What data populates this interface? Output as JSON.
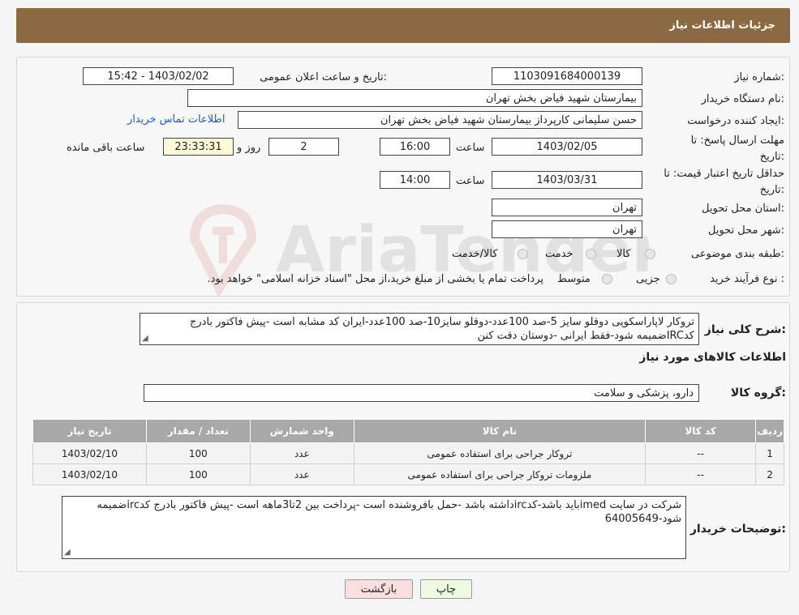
{
  "header": {
    "title": "جزئیات اطلاعات نیاز"
  },
  "form": {
    "need_number": {
      "label": "شماره نیاز:",
      "value": "1103091684000139"
    },
    "announce_datetime": {
      "label": "تاریخ و ساعت اعلان عمومی:",
      "value": "1403/02/02 - 15:42"
    },
    "buyer_org": {
      "label": "نام دستگاه خریدار:",
      "value": "بیمارستان شهید فیاض بخش تهران"
    },
    "requester": {
      "label": "ایجاد کننده درخواست:",
      "value": "حسن سلیمانی کارپرداز بیمارستان شهید فیاض بخش تهران"
    },
    "buyer_contact_link": "اطلاعات تماس خریدار",
    "reply_deadline": {
      "label_line1": "مهلت ارسال پاسخ: تا",
      "label_line2": "تاریخ:",
      "date": "1403/02/05",
      "time_label": "ساعت",
      "time": "16:00",
      "days": "2",
      "days_label": "روز و",
      "remaining": "23:33:31",
      "remaining_label": "ساعت باقی مانده"
    },
    "price_validity": {
      "label_line1": "حداقل تاریخ اعتبار قیمت: تا",
      "label_line2": "تاریخ:",
      "date": "1403/03/31",
      "time_label": "ساعت",
      "time": "14:00"
    },
    "delivery_province": {
      "label": "استان محل تحویل:",
      "value": "تهران"
    },
    "delivery_city": {
      "label": "شهر محل تحویل:",
      "value": "تهران"
    },
    "category": {
      "label": "طبقه بندی موضوعی:",
      "options": [
        "کالا",
        "خدمت",
        "کالا/خدمت"
      ]
    },
    "purchase_process": {
      "label": "نوع فرآیند خرید :",
      "options": [
        "جزیی",
        "متوسط"
      ],
      "note": "پرداخت تمام یا بخشی از مبلغ خرید،از محل \"اسناد خزانه اسلامی\" خواهد بود."
    }
  },
  "description": {
    "label": "شرح کلی نیاز:",
    "text": "تروکار لاپاراسکوپی دوقلو سایز 5-صد 100عدد-دوقلو سایز10-صد 100عدد-ایران کد مشابه است -پیش فاکتور بادرج کدIRCضمیمه شود-فقط ایرانی -دوستان دقت کنن"
  },
  "goods": {
    "section_title": "اطلاعات کالاهای مورد نیاز",
    "group_label": "گروه کالا:",
    "group_value": "دارو، پزشکی و سلامت",
    "columns": [
      "ردیف",
      "کد کالا",
      "نام کالا",
      "واحد شمارش",
      "تعداد / مقدار",
      "تاریخ نیاز"
    ],
    "rows": [
      [
        "1",
        "--",
        "تروکار جراحی برای استفاده عمومی",
        "عدد",
        "100",
        "1403/02/10"
      ],
      [
        "2",
        "--",
        "ملزومات تروکار جراحی برای استفاده عمومی",
        "عدد",
        "100",
        "1403/02/10"
      ]
    ]
  },
  "buyer_notes": {
    "label": "توضیحات خریدار:",
    "text": "شرکت در سایت imedباید باشد-کدircداشته باشد -حمل بافروشنده است -پرداخت بین 2تا3ماهه است -پیش فاکتور بادرج کدircضمیمه شود-64005649"
  },
  "buttons": {
    "print": "چاپ",
    "back": "بازگشت"
  },
  "watermark": "AriaTender.neT",
  "colors": {
    "header_bg": "#8b6a43",
    "link": "#1a5fb4",
    "back_button_bg": "#fbdede",
    "print_button_bg": "#eefbe3"
  }
}
